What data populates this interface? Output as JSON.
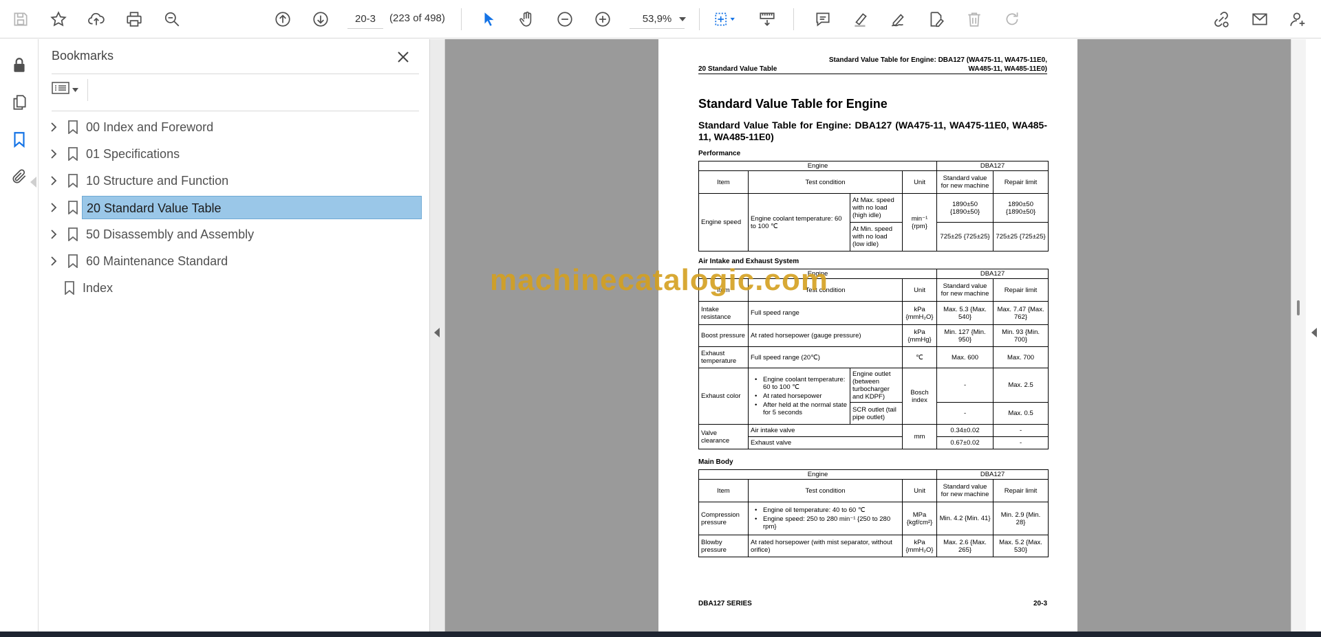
{
  "toolbar": {
    "page_input": "20-3",
    "page_count": "(223 of 498)",
    "zoom": "53,9%",
    "icons": [
      "save-icon",
      "star-icon",
      "upload-icon",
      "print-icon",
      "find-icon",
      "prev-page-icon",
      "next-page-icon",
      "select-cursor-icon",
      "hand-icon",
      "zoom-out-icon",
      "zoom-in-icon",
      "fit-page-icon",
      "scroll-mode-icon",
      "comment-icon",
      "highlight-icon",
      "sign-icon",
      "edit-pdf-icon",
      "delete-icon",
      "redo-icon",
      "share-link-icon",
      "email-icon",
      "account-icon"
    ],
    "accent_color": "#1473e6"
  },
  "rail": {
    "icons": [
      "lock-icon",
      "pages-icon",
      "bookmark-icon",
      "attachment-icon"
    ],
    "active": "bookmark-icon"
  },
  "bookmarks": {
    "title": "Bookmarks",
    "items": [
      {
        "label": "00 Index and Foreword",
        "expandable": true,
        "selected": false
      },
      {
        "label": "01 Specifications",
        "expandable": true,
        "selected": false
      },
      {
        "label": "10 Structure and Function",
        "expandable": true,
        "selected": false
      },
      {
        "label": "20 Standard Value Table",
        "expandable": true,
        "selected": true
      },
      {
        "label": "50 Disassembly and Assembly",
        "expandable": true,
        "selected": false
      },
      {
        "label": "60 Maintenance Standard",
        "expandable": true,
        "selected": false
      },
      {
        "label": "Index",
        "expandable": false,
        "selected": false
      }
    ],
    "selected_color": "#9ac7e8"
  },
  "document": {
    "header_right_1": "Standard Value Table for Engine: DBA127 (WA475-11, WA475-11E0,",
    "header_right_2": "WA485-11, WA485-11E0)",
    "header_left": "20 Standard Value Table",
    "title": "Standard Value Table for Engine",
    "subtitle": "Standard Value Table for Engine: DBA127 (WA475-11, WA475-11E0, WA485-11, WA485-11E0)",
    "common": {
      "engine": "Engine",
      "model": "DBA127",
      "item": "Item",
      "test_condition": "Test condition",
      "unit": "Unit",
      "std_value": "Standard value for new machine",
      "repair_limit": "Repair limit"
    },
    "performance": {
      "section": "Performance",
      "item": "Engine speed",
      "condition": "Engine coolant temperature: 60 to 100 ℃",
      "unit": "min⁻¹ {rpm}",
      "rows": [
        {
          "sub": "At Max. speed with no load (high idle)",
          "std": "1890±50 {1890±50}",
          "limit": "1890±50 {1890±50}"
        },
        {
          "sub": "At Min. speed with no load (low idle)",
          "std": "725±25 {725±25}",
          "limit": "725±25 {725±25}"
        }
      ]
    },
    "air": {
      "section": "Air Intake and Exhaust System",
      "intake": {
        "item": "Intake resistance",
        "condition": "Full speed range",
        "unit": "kPa {mmH₂O}",
        "std": "Max. 5.3 {Max. 540}",
        "limit": "Max. 7.47 {Max. 762}"
      },
      "boost": {
        "item": "Boost pressure",
        "condition": "At rated horsepower (gauge pressure)",
        "unit": "kPa {mmHg}",
        "std": "Min. 127 {Min. 950}",
        "limit": "Min. 93 {Min. 700}"
      },
      "exhaust_temp": {
        "item": "Exhaust temperature",
        "condition": "Full speed range (20℃)",
        "unit": "℃",
        "std": "Max. 600",
        "limit": "Max. 700"
      },
      "exhaust_color": {
        "item": "Exhaust color",
        "bullets": [
          "Engine coolant temperature: 60 to 100 ℃",
          "At rated horsepower",
          "After held at the normal state for 5 seconds"
        ],
        "unit": "Bosch index",
        "rows": [
          {
            "sub": "Engine outlet (between turbocharger and KDPF)",
            "std": "-",
            "limit": "Max. 2.5"
          },
          {
            "sub": "SCR outlet (tail pipe outlet)",
            "std": "-",
            "limit": "Max. 0.5"
          }
        ]
      },
      "valve": {
        "item": "Valve clearance",
        "unit": "mm",
        "rows": [
          {
            "sub": "Air intake valve",
            "std": "0.34±0.02",
            "limit": "-"
          },
          {
            "sub": "Exhaust valve",
            "std": "0.67±0.02",
            "limit": "-"
          }
        ]
      }
    },
    "main": {
      "section": "Main Body",
      "compression": {
        "item": "Compression pressure",
        "bullets": [
          "Engine oil temperature: 40 to 60 ℃",
          "Engine speed: 250 to 280 min⁻¹ {250 to 280 rpm}"
        ],
        "unit": "MPa {kgf/cm²}",
        "std": "Min. 4.2 {Min. 41}",
        "limit": "Min. 2.9 {Min. 28}"
      },
      "blowby": {
        "item": "Blowby pressure",
        "condition": "At rated horsepower (with mist separator, without orifice)",
        "unit": "kPa {mmH₂O}",
        "std": "Max. 2.6 {Max. 265}",
        "limit": "Max. 5.2 {Max. 530}"
      }
    },
    "footer_left": "DBA127 SERIES",
    "footer_right": "20-3"
  },
  "watermark": "machinecatalogic.com"
}
